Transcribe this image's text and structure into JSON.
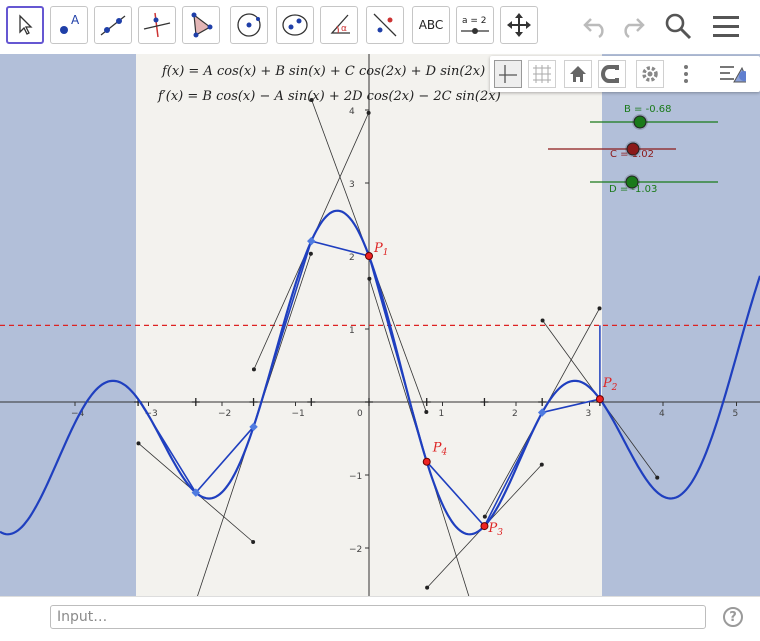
{
  "toolbar": {
    "tools": [
      {
        "name": "move-tool",
        "label": ""
      },
      {
        "name": "point-tool",
        "label": "A"
      },
      {
        "name": "line-tool",
        "label": ""
      },
      {
        "name": "perpendicular-tool",
        "label": ""
      },
      {
        "name": "polygon-tool",
        "label": ""
      },
      {
        "name": "circle-tool",
        "label": ""
      },
      {
        "name": "ellipse-tool",
        "label": ""
      },
      {
        "name": "angle-tool",
        "label": "α"
      },
      {
        "name": "reflect-tool",
        "label": ""
      },
      {
        "name": "text-tool",
        "label": "ABC"
      },
      {
        "name": "slider-tool",
        "label": "a = 2"
      },
      {
        "name": "move-graphics-view-tool",
        "label": ""
      }
    ],
    "undo_icon": "undo-icon",
    "redo_icon": "redo-icon",
    "search_icon": "search-icon",
    "menu_icon": "menu-icon"
  },
  "graphics_style_bar": {
    "buttons": [
      "axes-icon",
      "grid-icon",
      "home-icon",
      "snap-icon",
      "settings-icon",
      "more-icon",
      "toggle-style-bar-icon"
    ]
  },
  "formulas": {
    "f": "f(x) = A cos(x) + B sin(x) + C cos(2x) + D sin(2x)",
    "fprime": "f′(x) = B cos(x) − A sin(x) + 2D cos(2x) − 2C sin(2x)"
  },
  "sliders": [
    {
      "name": "B",
      "label": "B = -0.68",
      "value": -0.68,
      "color": "#1a7a1a"
    },
    {
      "name": "C",
      "label": "C = 1.02",
      "value": 1.02,
      "color": "#8b1a1a"
    },
    {
      "name": "D",
      "label": "D = -1.03",
      "value": -1.03,
      "color": "#1a7a1a"
    }
  ],
  "points": [
    {
      "label": "P",
      "sub": "1"
    },
    {
      "label": "P",
      "sub": "2"
    },
    {
      "label": "P",
      "sub": "3"
    },
    {
      "label": "P",
      "sub": "4"
    }
  ],
  "axes": {
    "x_ticks": [
      "−4",
      "−3",
      "−2",
      "−1",
      "0",
      "1",
      "2",
      "3",
      "4",
      "5"
    ],
    "y_ticks": [
      "−2",
      "−1",
      "1",
      "2",
      "3",
      "4"
    ],
    "y_line_value": 1.05
  },
  "chart_data": {
    "type": "line",
    "series": [
      {
        "name": "f",
        "x": [
          -5,
          -4.5,
          -4,
          -3.5,
          -3.14,
          -2.5,
          -2,
          -1.5,
          -1,
          -0.5,
          0,
          0.5,
          1,
          1.5,
          2,
          2.5,
          3,
          3.14,
          3.5,
          4,
          4.5,
          5
        ],
        "y": [
          -1.8,
          -0.6,
          0.3,
          0.27,
          0,
          -1.3,
          -0.8,
          0.5,
          1.8,
          2.6,
          2.0,
          0.4,
          -1.0,
          -1.7,
          -1.1,
          0,
          0.35,
          0,
          -0.6,
          -1.3,
          -0.9,
          0.6
        ]
      }
    ],
    "points": [
      {
        "x": 0,
        "y": 2.0
      },
      {
        "x": 3.14,
        "y": 0
      },
      {
        "x": 1.57,
        "y": -1.7
      },
      {
        "x": 0.79,
        "y": -0.8
      }
    ],
    "xlim": [
      -5,
      5.2
    ],
    "ylim": [
      -2.6,
      4.2
    ]
  },
  "input_bar": {
    "placeholder": "Input…",
    "help": "?"
  }
}
